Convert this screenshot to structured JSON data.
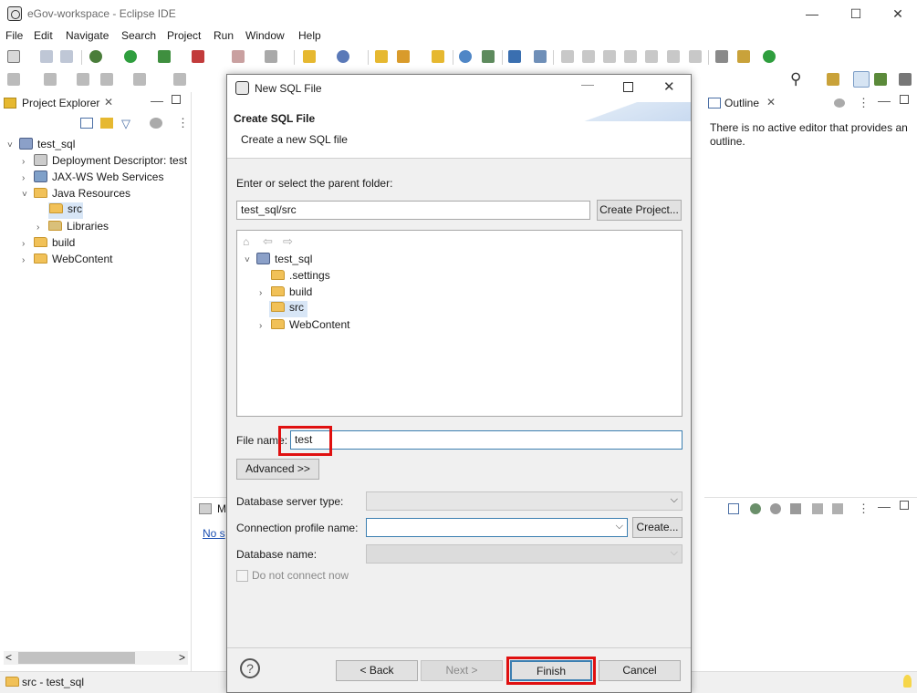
{
  "window": {
    "title": "eGov-workspace - Eclipse IDE",
    "minimize": "—",
    "maximize": "☐",
    "close": "✕"
  },
  "menu": [
    "File",
    "Edit",
    "Navigate",
    "Search",
    "Project",
    "Run",
    "Window",
    "Help"
  ],
  "left_panel": {
    "tab_label": "Project Explorer",
    "tree": [
      {
        "label": "test_sql",
        "twisty": "˅",
        "kind": "project"
      },
      {
        "label": "Deployment Descriptor: test",
        "twisty": "›",
        "kind": "descriptor"
      },
      {
        "label": "JAX-WS Web Services",
        "twisty": "›",
        "kind": "webservice"
      },
      {
        "label": "Java Resources",
        "twisty": "˅",
        "kind": "resources"
      },
      {
        "label": "src",
        "twisty": "",
        "kind": "package-folder"
      },
      {
        "label": "Libraries",
        "twisty": "›",
        "kind": "library"
      },
      {
        "label": "build",
        "twisty": "›",
        "kind": "folder"
      },
      {
        "label": "WebContent",
        "twisty": "›",
        "kind": "folder"
      }
    ],
    "scroll_left": "<",
    "scroll_right": ">"
  },
  "right_panel": {
    "tab_label": "Outline",
    "message": "There is no active editor that provides an outline."
  },
  "mid_bottom": {
    "tab_label": "M",
    "link_text": "No s"
  },
  "status_bar": {
    "text": "src - test_sql"
  },
  "dialog": {
    "title": "New SQL File",
    "heading": "Create SQL File",
    "subheading": "Create a new SQL file",
    "parent_folder_label": "Enter or select the parent folder:",
    "parent_folder_value": "test_sql/src",
    "create_project_button": "Create Project...",
    "folder_tree": [
      {
        "label": "test_sql",
        "twisty": "˅",
        "kind": "project"
      },
      {
        "label": ".settings",
        "twisty": "",
        "kind": "folder"
      },
      {
        "label": "build",
        "twisty": "›",
        "kind": "folder"
      },
      {
        "label": "src",
        "twisty": "",
        "kind": "folder",
        "selected": true
      },
      {
        "label": "WebContent",
        "twisty": "›",
        "kind": "folder"
      }
    ],
    "file_name_label": "File name:",
    "file_name_value": "test",
    "advanced_button": "Advanced >>",
    "db_server_type_label": "Database server type:",
    "db_server_type_value": "",
    "connection_profile_label": "Connection profile name:",
    "connection_profile_value": "",
    "create_button": "Create...",
    "database_name_label": "Database name:",
    "database_name_value": "",
    "do_not_connect_label": "Do not connect now",
    "do_not_connect_checked": false,
    "help_icon": "?",
    "back_button": "< Back",
    "next_button": "Next >",
    "finish_button": "Finish",
    "cancel_button": "Cancel"
  },
  "colors": {
    "highlight": "#e01010",
    "folder": "#f1c158",
    "selected_row": "#d8e6f6"
  }
}
